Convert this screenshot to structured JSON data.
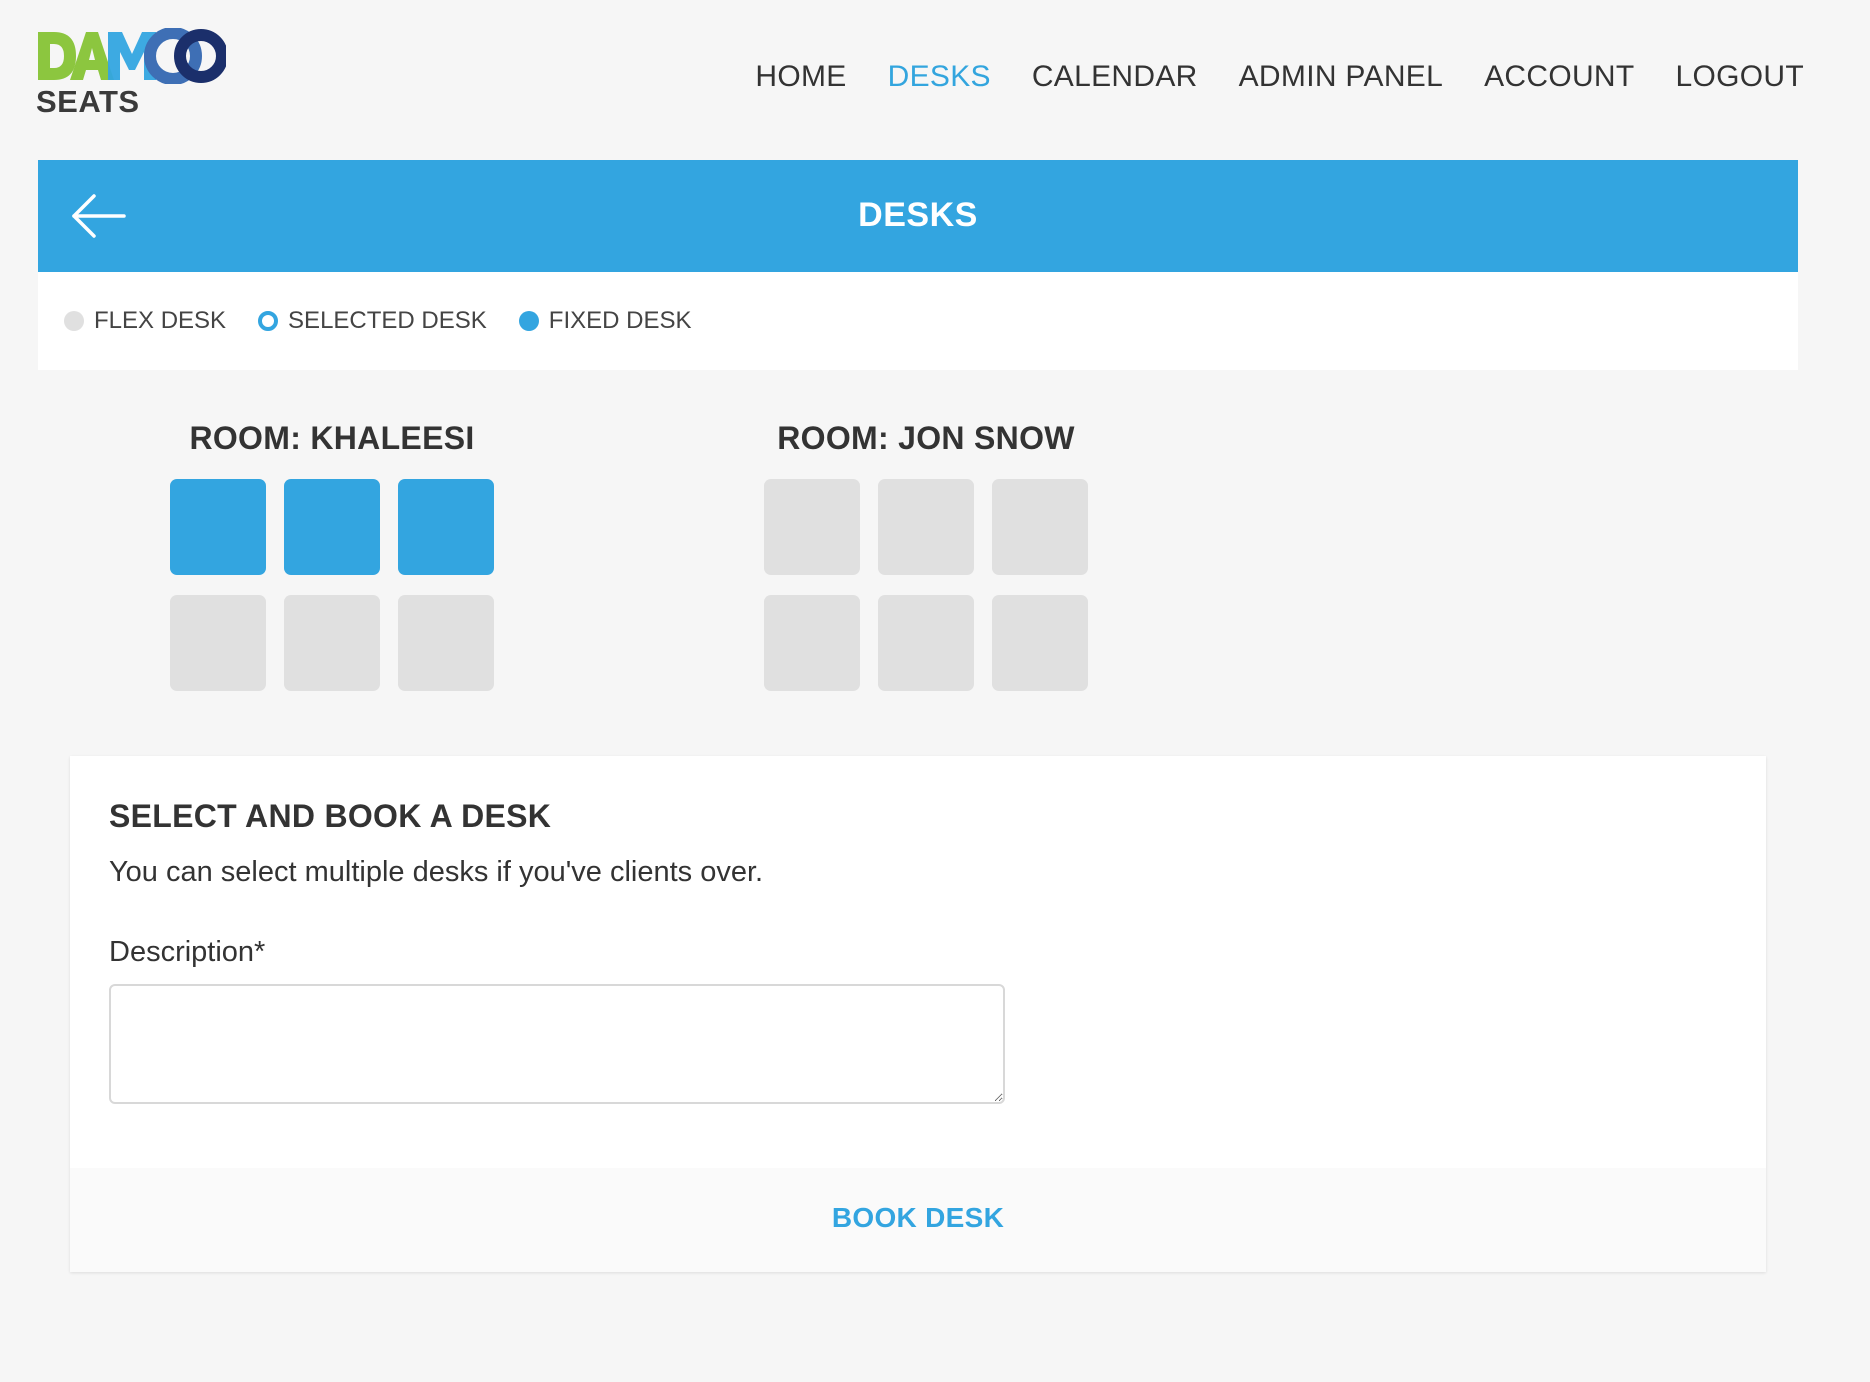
{
  "logo": {
    "wordmark": "DAMCO",
    "product": "SEATS",
    "colors": {
      "green": "#8cc63f",
      "blue": "#33a5e0",
      "navy": "#1b2f6b"
    }
  },
  "nav": {
    "items": [
      {
        "label": "HOME",
        "active": false
      },
      {
        "label": "DESKS",
        "active": true
      },
      {
        "label": "CALENDAR",
        "active": false
      },
      {
        "label": "ADMIN PANEL",
        "active": false
      },
      {
        "label": "ACCOUNT",
        "active": false
      },
      {
        "label": "LOGOUT",
        "active": false
      }
    ]
  },
  "page": {
    "title": "DESKS",
    "back_icon": "arrow-left-icon"
  },
  "legend": {
    "flex": "FLEX DESK",
    "selected": "SELECTED DESK",
    "fixed": "FIXED DESK"
  },
  "rooms": [
    {
      "title": "ROOM: KHALEESI",
      "desks": [
        "fixed",
        "fixed",
        "fixed",
        "flex",
        "flex",
        "flex"
      ]
    },
    {
      "title": "ROOM: JON SNOW",
      "desks": [
        "flex",
        "flex",
        "flex",
        "flex",
        "flex",
        "flex"
      ]
    }
  ],
  "booking": {
    "heading": "SELECT AND BOOK A DESK",
    "subtext": "You can select multiple desks if you've clients over.",
    "description_label": "Description*",
    "description_value": "",
    "button_label": "BOOK DESK"
  },
  "colors": {
    "accent": "#33a5e0",
    "flex_desk": "#e0e0e0",
    "background": "#f6f6f6"
  }
}
